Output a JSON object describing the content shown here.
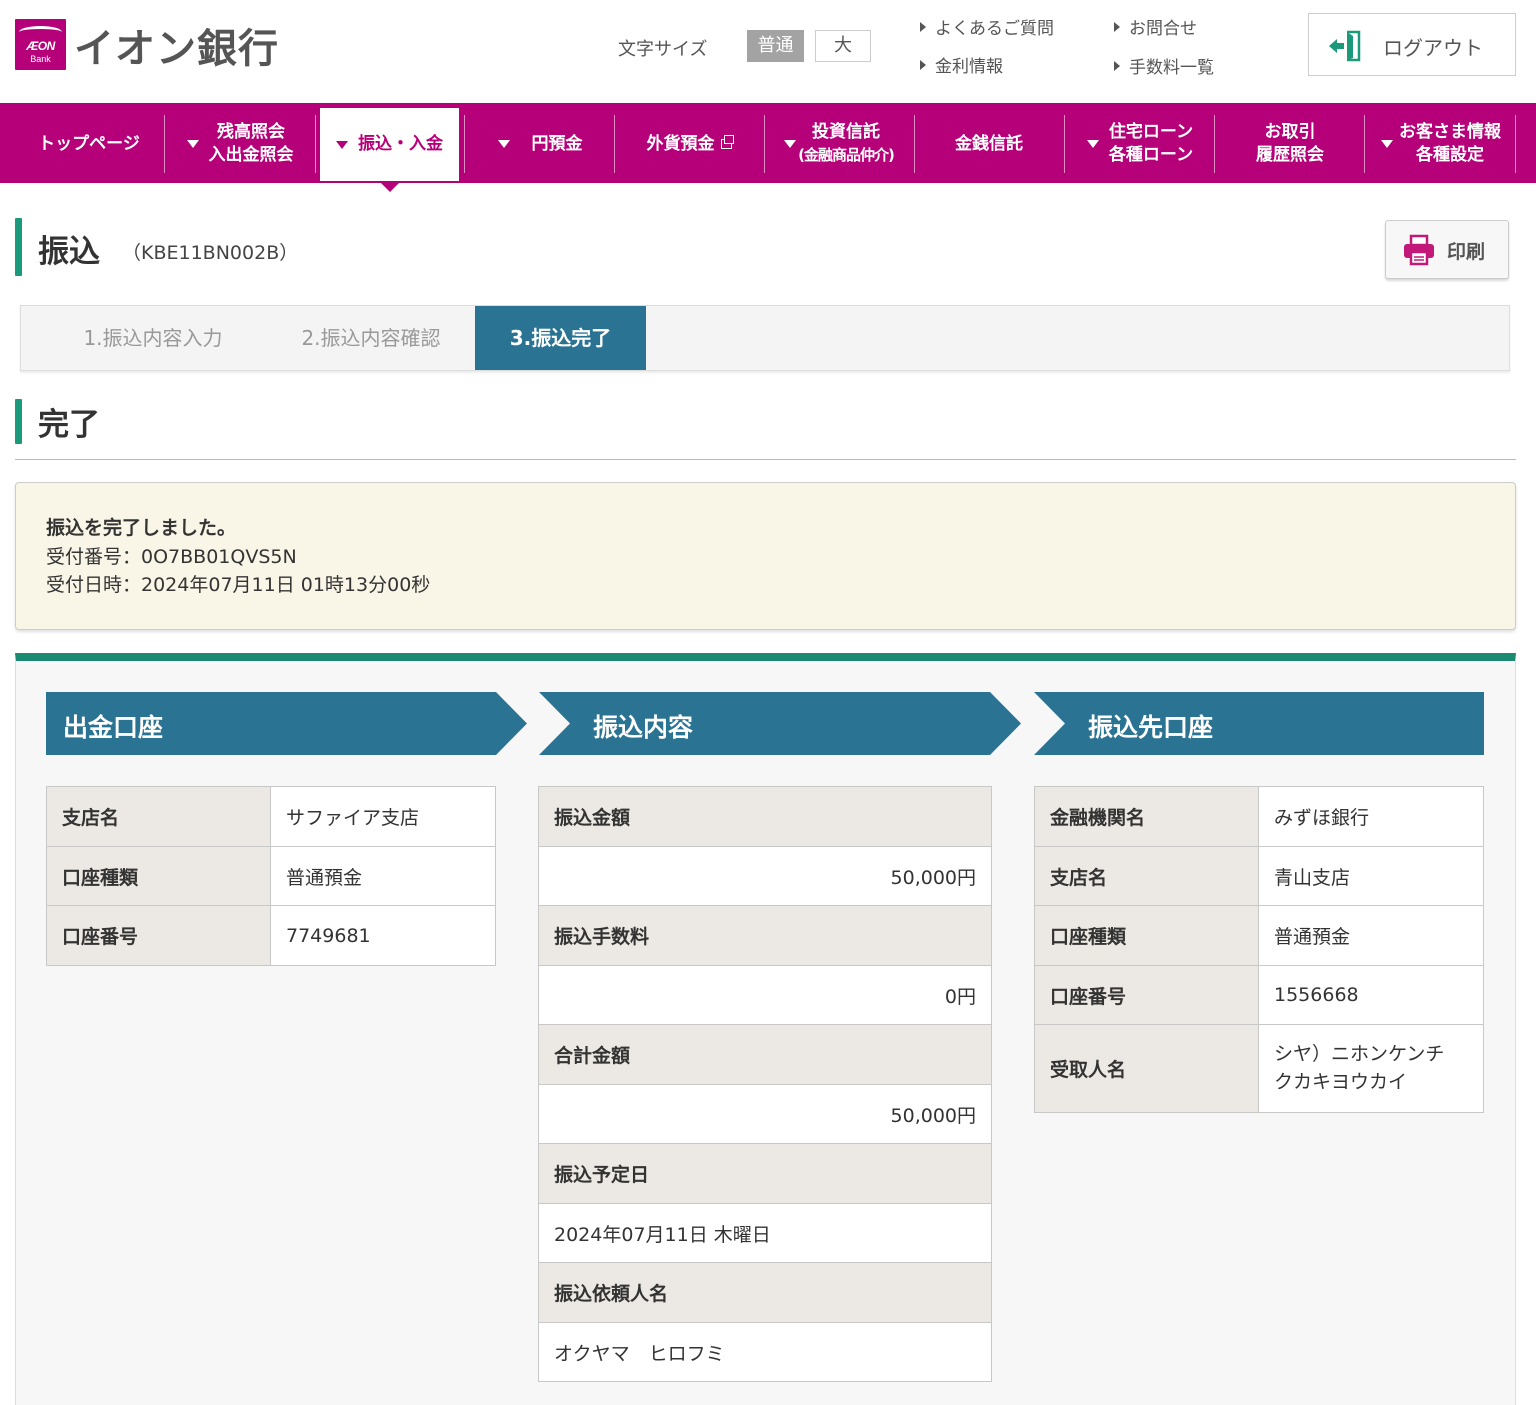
{
  "header": {
    "logo_text": "イオン銀行",
    "logo_mark_aeon": "ÆON",
    "logo_mark_bank": "Bank",
    "font_size_label": "文字サイズ",
    "font_size_normal": "普通",
    "font_size_large": "大",
    "links": {
      "faq": "よくあるご質問",
      "contact": "お問合せ",
      "rates": "金利情報",
      "fees": "手数料一覧"
    },
    "logout_label": "ログアウト"
  },
  "nav": {
    "top": "トップページ",
    "balance_line1": "残高照会",
    "balance_line2": "入出金照会",
    "transfer": "振込・入金",
    "yen_deposit": "円預金",
    "fx_deposit": "外貨預金",
    "invest_line1": "投資信託",
    "invest_line2": "(金融商品仲介)",
    "money_trust": "金銭信託",
    "loan_line1": "住宅ローン",
    "loan_line2": "各種ローン",
    "history_line1": "お取引",
    "history_line2": "履歴照会",
    "settings_line1": "お客さま情報",
    "settings_line2": "各種設定"
  },
  "page": {
    "title": "振込",
    "code": "（KBE11BN002B）",
    "print_label": "印刷"
  },
  "steps": [
    "1.振込内容入力",
    "2.振込内容確認",
    "3.振込完了"
  ],
  "section_title": "完了",
  "notice": {
    "message": "振込を完了しました。",
    "receipt_number": "受付番号：0O7BB01QVS5N",
    "receipt_datetime": "受付日時：2024年07月11日 01時13分00秒"
  },
  "source_account": {
    "header": "出金口座",
    "branch_label": "支店名",
    "branch_value": "サファイア支店",
    "type_label": "口座種類",
    "type_value": "普通預金",
    "number_label": "口座番号",
    "number_value": "7749681"
  },
  "transfer_details": {
    "header": "振込内容",
    "amount_label": "振込金額",
    "amount_value": "50,000円",
    "fee_label": "振込手数料",
    "fee_value": "0円",
    "total_label": "合計金額",
    "total_value": "50,000円",
    "date_label": "振込予定日",
    "date_value": "2024年07月11日 木曜日",
    "requester_label": "振込依頼人名",
    "requester_value": "オクヤマ　ヒロフミ"
  },
  "destination_account": {
    "header": "振込先口座",
    "bank_label": "金融機関名",
    "bank_value": "みずほ銀行",
    "branch_label": "支店名",
    "branch_value": "青山支店",
    "type_label": "口座種類",
    "type_value": "普通預金",
    "number_label": "口座番号",
    "number_value": "1556668",
    "payee_label": "受取人名",
    "payee_value_line1": "シヤ）ニホンケンチ",
    "payee_value_line2": "クカキヨウカイ"
  },
  "colors": {
    "brand": "#b6007a",
    "accent_green": "#1a9a7a",
    "step_active": "#2a7392",
    "section_header": "#2a7392",
    "notice_bg": "#faf6e7"
  },
  "icons": {
    "logout": "logout-door-icon",
    "print": "printer-icon",
    "dropdown": "triangle-down-icon",
    "external": "external-window-icon",
    "link_bullet": "triangle-right-icon"
  }
}
